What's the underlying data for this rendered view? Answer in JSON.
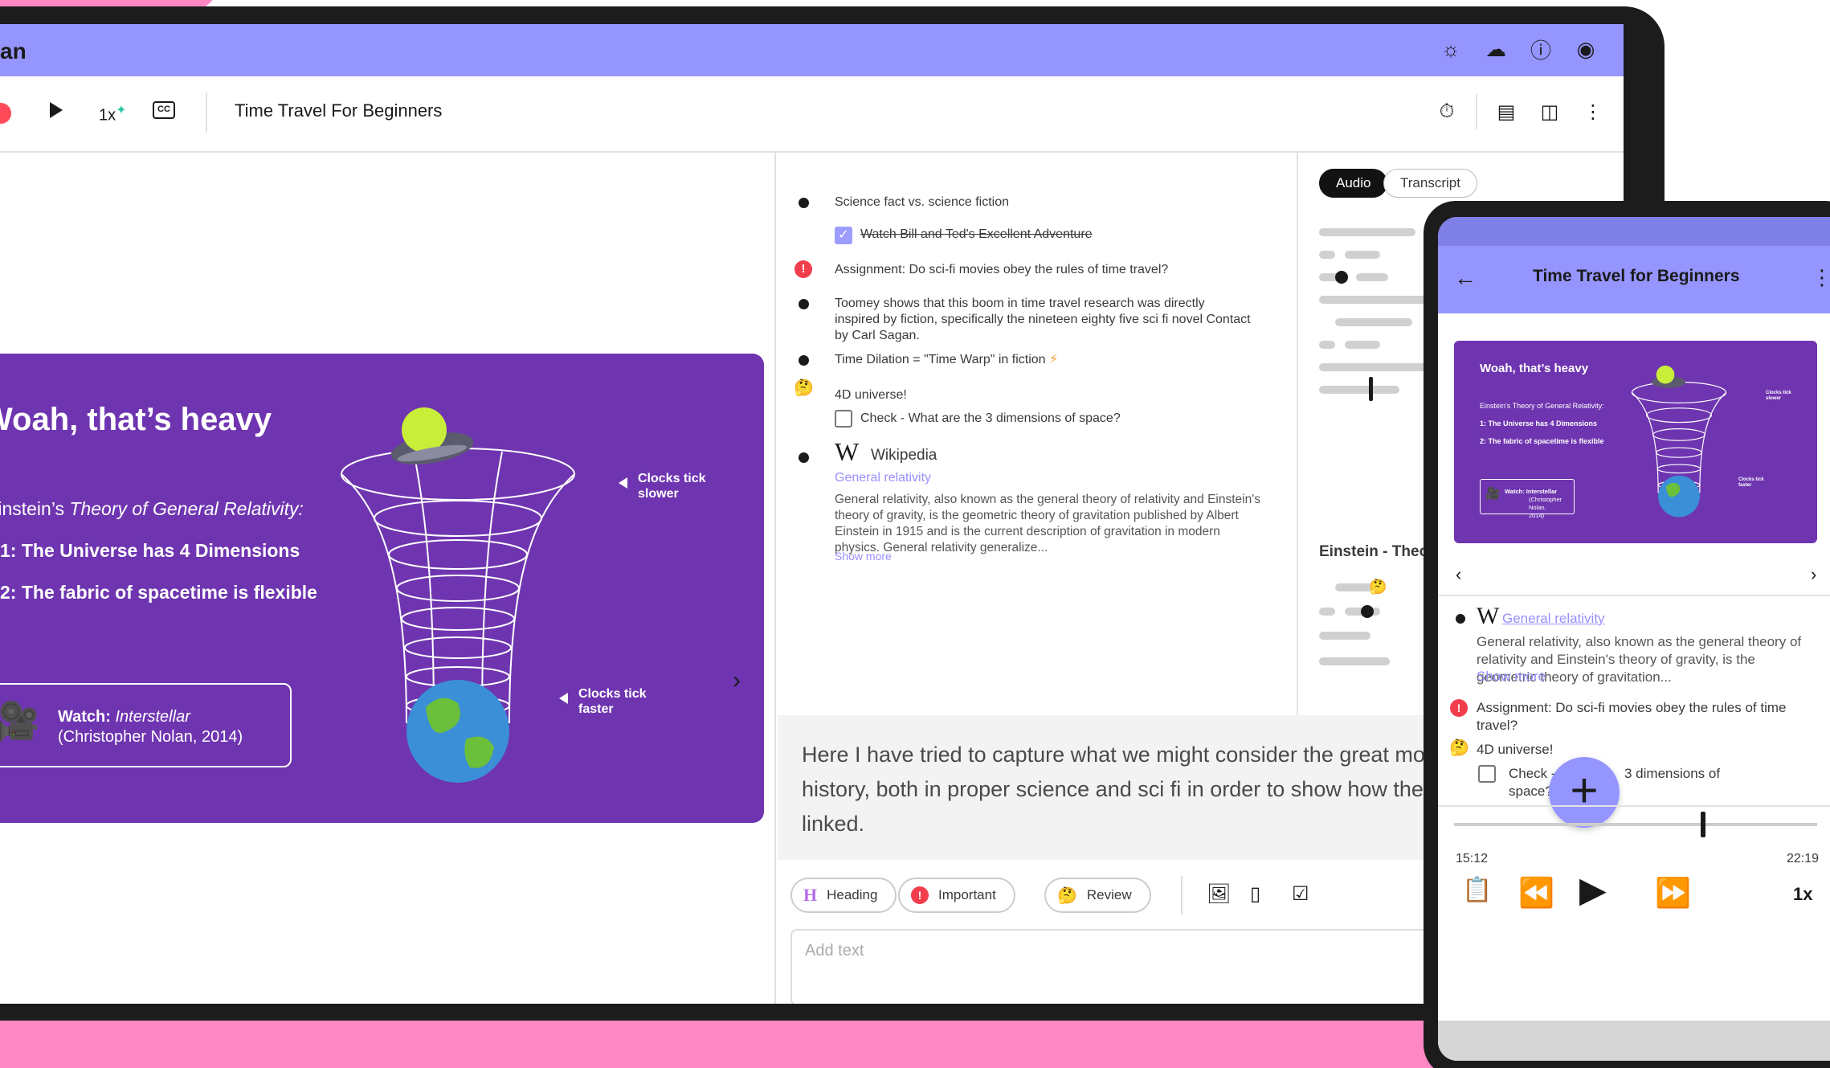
{
  "app": {
    "title_fragment": "an"
  },
  "toolbar": {
    "speed": "1x",
    "cc_label": "CC",
    "doc_title": "Time Travel For Beginners"
  },
  "slide": {
    "heading": "Woah, that’s heavy",
    "line1_prefix": "Einstein’s ",
    "line1_italic": "Theory of General Relativity:",
    "point1": "1: The Universe has 4 Dimensions",
    "point2": "2: The fabric of spacetime is flexible",
    "watch_prefix": "Watch: ",
    "watch_italic": "Interstellar",
    "watch_credit": "(Christopher Nolan, 2014)",
    "label_top": "Clocks tick slower",
    "label_bottom": "Clocks tick faster"
  },
  "notes": [
    {
      "type": "bullet",
      "text": "Science fact vs. science fiction"
    },
    {
      "type": "check-done",
      "text": "Watch Bill and Ted's Excellent Adventure"
    },
    {
      "type": "important",
      "text": "Assignment: Do sci-fi movies obey the rules of time travel?"
    },
    {
      "type": "bullet",
      "text": "Toomey shows that this boom in time travel research was directly inspired by fiction, specifically the nineteen eighty five sci fi novel Contact by Carl Sagan."
    },
    {
      "type": "bullet",
      "text": "Time Dilation = \"Time Warp\" in fiction"
    },
    {
      "type": "review",
      "text": "4D universe!"
    },
    {
      "type": "check",
      "text": "Check - What are the 3 dimensions of space?"
    }
  ],
  "wiki": {
    "source": "Wikipedia",
    "link": "General relativity",
    "body": "General relativity, also known as the general theory of relativity and Einstein's theory of gravity, is the geometric theory of gravitation published by Albert Einstein in 1915 and is the current description of gravitation in modern physics. General relativity generalize...",
    "show_more": "Show more"
  },
  "media_tabs": {
    "audio": "Audio",
    "transcript": "Transcript"
  },
  "right_pane": {
    "section_title": "Einstein - Theo"
  },
  "transcript_text": "Here I have tried to capture what we might consider the great moments in time travel history, both in proper science and sci fi in order to show how the two are actually closely linked.",
  "editor": {
    "heading_tag": "Heading",
    "important_tag": "Important",
    "review_tag": "Review",
    "placeholder": "Add text"
  },
  "phone": {
    "title": "Time Travel for Beginners",
    "slide_heading": "Woah, that’s heavy",
    "slide_line1": "Einstein's Theory of General Relativity:",
    "slide_point1": "1: The Universe has 4 Dimensions",
    "slide_point2": "2: The fabric of spacetime is flexible",
    "slide_watch": "Watch: Interstellar",
    "slide_credit": "(Christopher Nolan, 2014)",
    "slide_label_top": "Clocks tick slower",
    "slide_label_bottom": "Clocks tick faster",
    "wiki_link": "General relativity",
    "wiki_body": "General relativity, also known as the general theory of relativity and Einstein's theory of gravity, is the geometric theory of gravitation...",
    "show_more": "Show more",
    "assignment": "Assignment: Do sci-fi movies obey the rules of time travel?",
    "review": "4D universe!",
    "check_prefix": "Check - Wh",
    "check_suffix": "3 dimensions of",
    "check_line2": "space?",
    "time_elapsed": "15:12",
    "time_total": "22:19",
    "speed": "1x",
    "progress_fraction": 0.68
  },
  "colors": {
    "accent": "#9595ff",
    "slide_purple": "#6f35b0",
    "background_pink": "#ff88c4",
    "alert_red": "#f23d4d",
    "link": "#9a8fff"
  }
}
